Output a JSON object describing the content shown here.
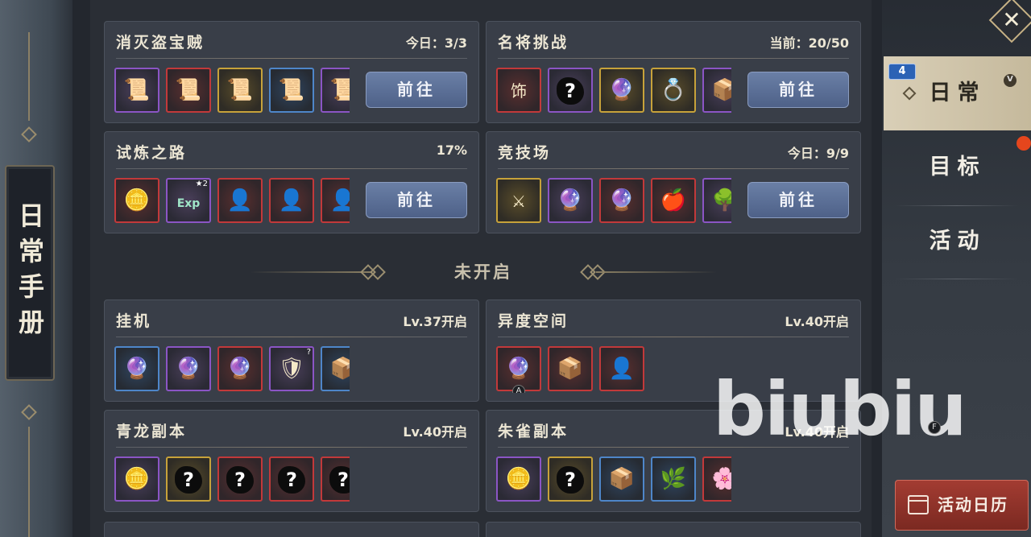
{
  "side_vertical_tab": {
    "label": "日常手册"
  },
  "close_label": "✕",
  "active_cards": [
    {
      "title": "消灭盗宝贼",
      "status": "今日：3/3",
      "button": "前往",
      "items": [
        {
          "frame": "purple",
          "icon": "📜"
        },
        {
          "frame": "red",
          "icon": "📜"
        },
        {
          "frame": "gold",
          "icon": "📜"
        },
        {
          "frame": "blue",
          "icon": "📜"
        },
        {
          "frame": "purple",
          "icon": "📜"
        }
      ]
    },
    {
      "title": "名将挑战",
      "status": "当前：20/50",
      "button": "前往",
      "items": [
        {
          "frame": "red",
          "icon": "饰"
        },
        {
          "frame": "purple",
          "mystery": "?"
        },
        {
          "frame": "gold",
          "icon": "🔮"
        },
        {
          "frame": "gold",
          "icon": "💍"
        },
        {
          "frame": "purple",
          "icon": "📦"
        }
      ]
    },
    {
      "title": "试炼之路",
      "status": "17%",
      "button": "前往",
      "items": [
        {
          "frame": "red",
          "icon": "🪙"
        },
        {
          "frame": "purple",
          "icon": "Exp",
          "sub": "★2"
        },
        {
          "frame": "red",
          "icon": "👤"
        },
        {
          "frame": "red",
          "icon": "👤"
        },
        {
          "frame": "red",
          "icon": "👤"
        }
      ]
    },
    {
      "title": "竞技场",
      "status": "今日：9/9",
      "button": "前往",
      "items": [
        {
          "frame": "gold",
          "icon": "⚔"
        },
        {
          "frame": "purple",
          "icon": "🔮"
        },
        {
          "frame": "red",
          "icon": "🔮"
        },
        {
          "frame": "red",
          "icon": "🍎"
        },
        {
          "frame": "purple",
          "icon": "🌳"
        }
      ]
    }
  ],
  "divider_label": "未开启",
  "locked_cards": [
    {
      "title": "挂机",
      "status": "Lv.37开启",
      "items": [
        {
          "frame": "blue",
          "icon": "🔮"
        },
        {
          "frame": "purple",
          "icon": "🔮"
        },
        {
          "frame": "red",
          "icon": "🔮"
        },
        {
          "frame": "purple",
          "icon": "🛡",
          "sub": "?"
        },
        {
          "frame": "blue",
          "icon": "📦"
        }
      ]
    },
    {
      "title": "异度空间",
      "status": "Lv.40开启",
      "items": [
        {
          "frame": "red",
          "icon": "🔮",
          "tag": "A"
        },
        {
          "frame": "red",
          "icon": "📦"
        },
        {
          "frame": "red",
          "icon": "👤"
        }
      ]
    },
    {
      "title": "青龙副本",
      "status": "Lv.40开启",
      "items": [
        {
          "frame": "purple",
          "icon": "🪙"
        },
        {
          "frame": "gold",
          "mystery": "?"
        },
        {
          "frame": "red",
          "mystery": "?"
        },
        {
          "frame": "red",
          "mystery": "?"
        },
        {
          "frame": "red",
          "mystery": "?"
        }
      ]
    },
    {
      "title": "朱雀副本",
      "status": "Lv.40开启",
      "items": [
        {
          "frame": "purple",
          "icon": "🪙"
        },
        {
          "frame": "gold",
          "mystery": "?"
        },
        {
          "frame": "blue",
          "icon": "📦"
        },
        {
          "frame": "blue",
          "icon": "🌿"
        },
        {
          "frame": "red",
          "icon": "🌸"
        }
      ]
    }
  ],
  "sidebar": {
    "badge": "4",
    "version_tag": "V",
    "tabs": [
      {
        "label": "日常",
        "active": true
      },
      {
        "label": "目标",
        "active": false
      },
      {
        "label": "活动",
        "active": false
      }
    ],
    "calendar_button": "活动日历"
  },
  "watermark": "biubiu",
  "watermark_tag": "F"
}
